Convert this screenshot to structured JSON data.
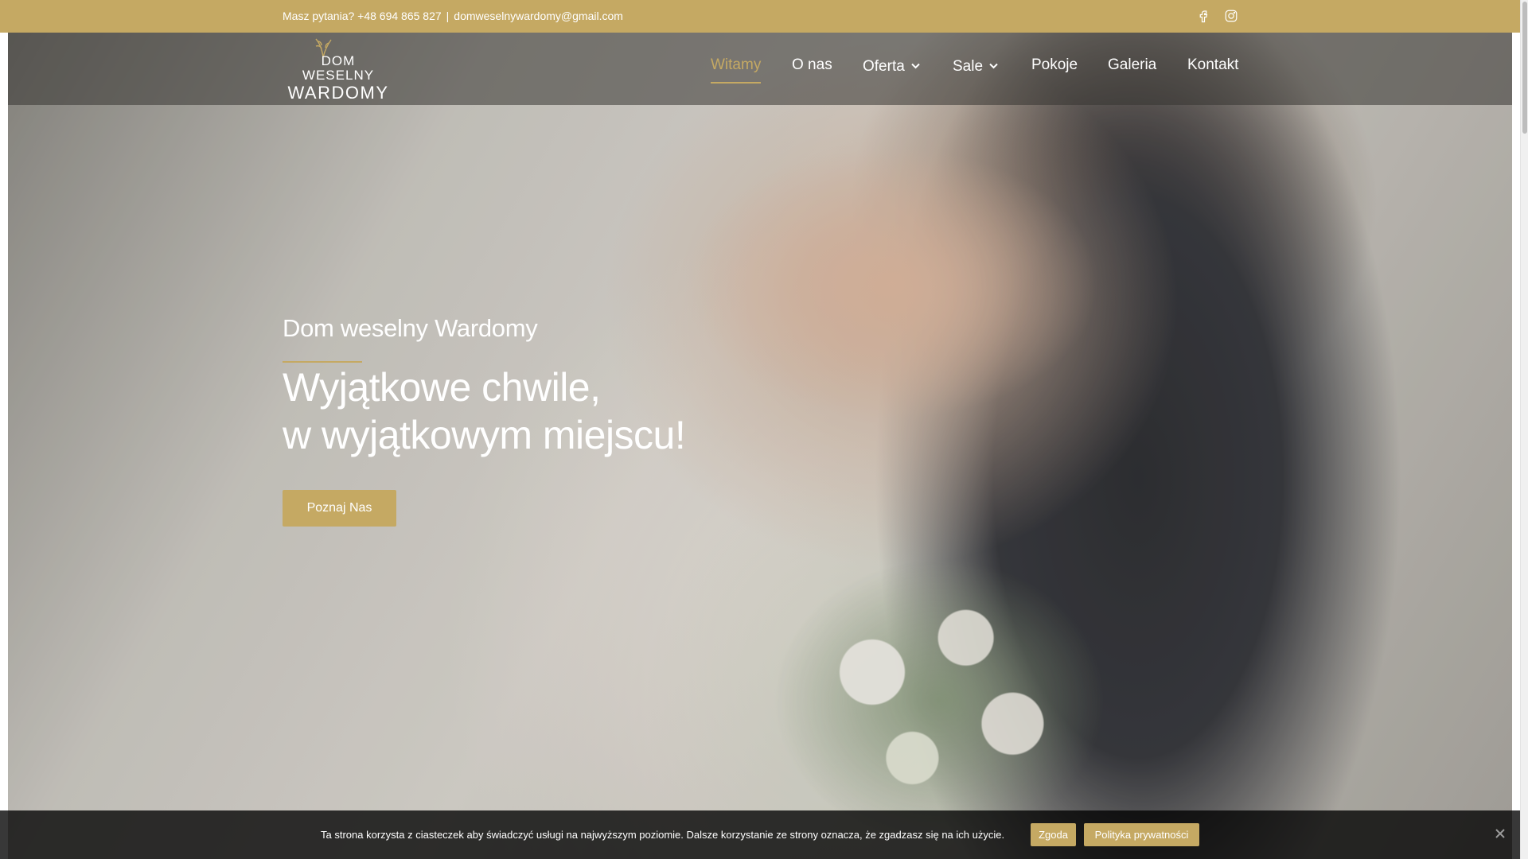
{
  "topbar": {
    "contact_prefix": "Masz pytania? +48 694 865 827",
    "separator": "|",
    "email": "domweselnywardomy@gmail.com",
    "social_icons": [
      "facebook-icon",
      "instagram-icon"
    ]
  },
  "logo": {
    "line1": "DOM",
    "line2": "WESELNY",
    "line3": "WARDOMY"
  },
  "nav": {
    "items": [
      {
        "label": "Witamy",
        "active": true
      },
      {
        "label": "O nas"
      },
      {
        "label": "Oferta",
        "dropdown": true
      },
      {
        "label": "Sale",
        "dropdown": true
      },
      {
        "label": "Pokoje"
      },
      {
        "label": "Galeria"
      },
      {
        "label": "Kontakt"
      }
    ]
  },
  "hero": {
    "eyebrow": "Dom weselny Wardomy",
    "headline_line1": "Wyjątkowe chwile,",
    "headline_line2": "w wyjątkowym miejscu!",
    "cta_label": "Poznaj Nas"
  },
  "cookie": {
    "text": "Ta strona korzysta z ciasteczek aby świadczyć usługi na najwyższym poziomie. Dalsze korzystanie ze strony oznacza, że zgadzasz się na ich użycie.",
    "agree_label": "Zgoda",
    "policy_label": "Polityka prywatności"
  },
  "colors": {
    "accent": "#c5a963",
    "overlay": "#373432",
    "cookie_bg": "#000000"
  }
}
